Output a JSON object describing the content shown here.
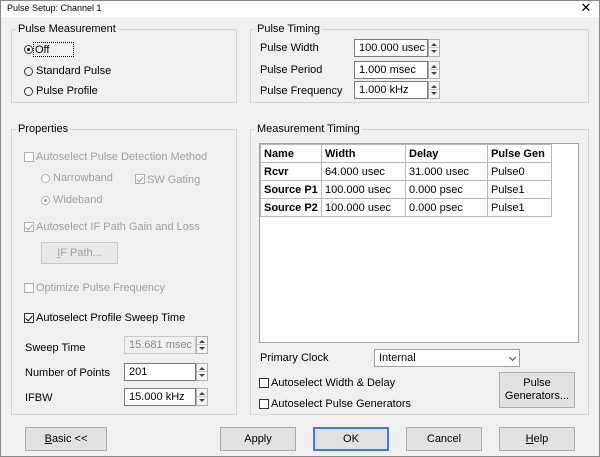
{
  "window": {
    "title": "Pulse Setup: Channel 1",
    "close_glyph": "✕"
  },
  "pulse_measurement": {
    "group_label": "Pulse Measurement",
    "options": [
      {
        "label": "Off",
        "selected": true
      },
      {
        "label": "Standard Pulse",
        "selected": false
      },
      {
        "label": "Pulse Profile",
        "selected": false
      }
    ]
  },
  "pulse_timing": {
    "group_label": "Pulse Timing",
    "width_label": "Pulse Width",
    "width_value": "100.000 usec",
    "period_label": "Pulse Period",
    "period_value": "1.000 msec",
    "frequency_label": "Pulse Frequency",
    "frequency_value": "1.000 kHz"
  },
  "properties": {
    "group_label": "Properties",
    "autoselect_detection_label": "Autoselect Pulse Detection Method",
    "narrowband_label": "Narrowband",
    "wideband_label": "Wideband",
    "sw_gating_label": "SW Gating",
    "autoselect_if_label": "Autoselect IF Path Gain and Loss",
    "if_path_button_prefix": "I",
    "if_path_button_rest": "F Path...",
    "optimize_label": "Optimize Pulse Frequency",
    "autoselect_sweep_label": "Autoselect Profile Sweep Time",
    "sweep_time_label": "Sweep Time",
    "sweep_time_value": "15.681 msec",
    "points_label": "Number of Points",
    "points_value": "201",
    "ifbw_label": "IFBW",
    "ifbw_value": "15.000 kHz"
  },
  "measurement_timing": {
    "group_label": "Measurement Timing",
    "columns": [
      "Name",
      "Width",
      "Delay",
      "Pulse Gen"
    ],
    "rows": [
      [
        "Rcvr",
        "64.000 usec",
        "31.000 usec",
        "Pulse0"
      ],
      [
        "Source P1",
        "100.000 usec",
        "0.000 psec",
        "Pulse1"
      ],
      [
        "Source P2",
        "100.000 usec",
        "0.000 psec",
        "Pulse1"
      ]
    ],
    "primary_clock_label": "Primary Clock",
    "primary_clock_value": "Internal",
    "autoselect_width_delay_label": "Autoselect Width & Delay",
    "autoselect_generators_label": "Autoselect Pulse Generators",
    "pulse_generators_line1": "Pulse",
    "pulse_generators_line2": "Generators..."
  },
  "footer": {
    "basic_prefix": "B",
    "basic_rest": "asic <<",
    "apply": "Apply",
    "ok": "OK",
    "cancel": "Cancel",
    "help_prefix": "H",
    "help_rest": "elp"
  },
  "colors": {
    "accent": "#3c7fd6",
    "window_bg": "#f0f0f0",
    "disabled_text": "#a0a0a0"
  }
}
